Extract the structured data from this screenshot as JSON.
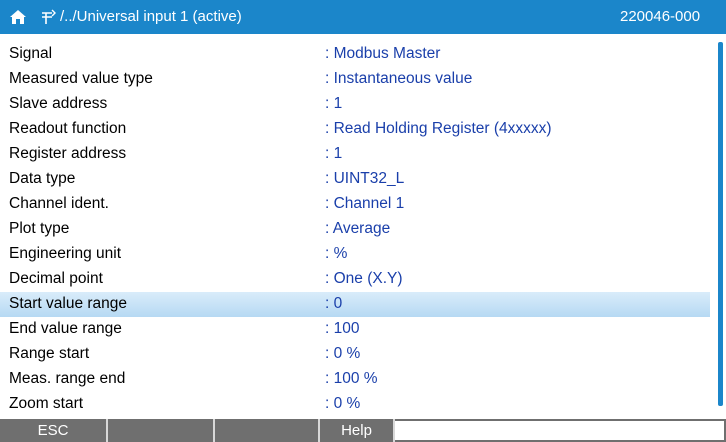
{
  "titlebar": {
    "path": "/../Universal input 1 (active)",
    "device_id": "220046-000",
    "home_icon": "home-icon",
    "path_icon": "navigation-fork-icon",
    "color": "#1b86ca"
  },
  "params": [
    {
      "label": "Signal",
      "value": ": Modbus Master"
    },
    {
      "label": "Measured value type",
      "value": ": Instantaneous value"
    },
    {
      "label": "Slave address",
      "value": ": 1"
    },
    {
      "label": "Readout function",
      "value": ": Read Holding Register (4xxxxx)"
    },
    {
      "label": "Register address",
      "value": ": 1"
    },
    {
      "label": "Data type",
      "value": ": UINT32_L"
    },
    {
      "label": "Channel ident.",
      "value": ": Channel 1"
    },
    {
      "label": "Plot type",
      "value": ": Average"
    },
    {
      "label": "Engineering unit",
      "value": ": %"
    },
    {
      "label": "Decimal point",
      "value": ": One (X.Y)"
    },
    {
      "label": "Start value range",
      "value": ": 0",
      "selected": true
    },
    {
      "label": "End value range",
      "value": ": 100"
    },
    {
      "label": "Range start",
      "value": ": 0 %"
    },
    {
      "label": "Meas. range end",
      "value": ": 100 %"
    },
    {
      "label": "Zoom start",
      "value": ": 0 %"
    }
  ],
  "softkeys": [
    "ESC",
    "",
    "",
    "Help",
    ""
  ]
}
